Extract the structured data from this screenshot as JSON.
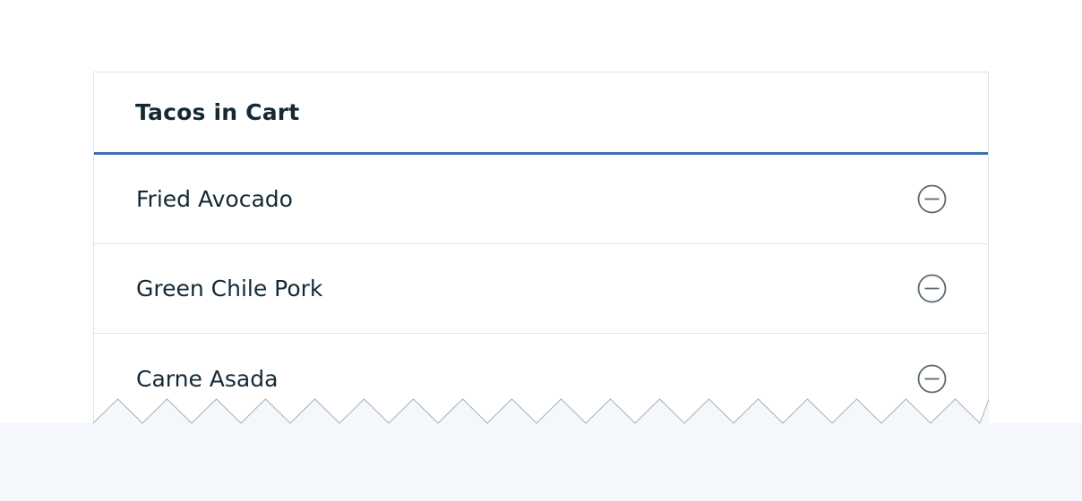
{
  "cart": {
    "title": "Tacos in Cart",
    "items": [
      {
        "label": "Fried Avocado",
        "action_icon": "minus-circle-icon"
      },
      {
        "label": "Green Chile Pork",
        "action_icon": "minus-circle-icon"
      },
      {
        "label": "Carne Asada",
        "action_icon": "minus-circle-icon"
      }
    ]
  },
  "colors": {
    "accent": "#3d70b2",
    "text": "#152935",
    "border": "#dfe3e6",
    "icon": "#5a6872",
    "background_band": "#f4f7fb"
  }
}
